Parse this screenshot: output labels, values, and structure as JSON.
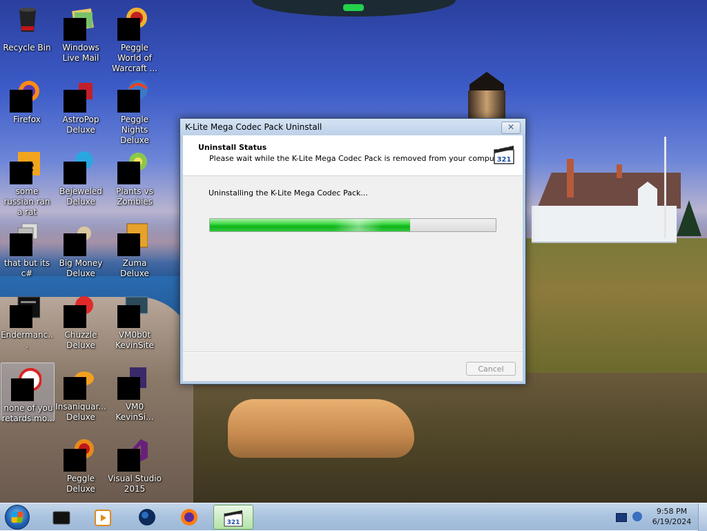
{
  "desktop": {
    "icons": [
      {
        "label": "Recycle Bin",
        "icon": "recycle-bin-icon"
      },
      {
        "label": "Windows Live Mail",
        "icon": "mail-icon"
      },
      {
        "label": "Peggle World of Warcraft ...",
        "icon": "game-icon"
      },
      {
        "label": "Firefox",
        "icon": "firefox-icon"
      },
      {
        "label": "AstroPop Deluxe",
        "icon": "game-icon"
      },
      {
        "label": "Peggle Nights Deluxe",
        "icon": "game-icon"
      },
      {
        "label": "some russian ran a rat",
        "icon": "app-icon"
      },
      {
        "label": "Bejeweled Deluxe",
        "icon": "game-icon"
      },
      {
        "label": "Plants vs Zombies",
        "icon": "game-icon"
      },
      {
        "label": "that but its c#",
        "icon": "app-icon"
      },
      {
        "label": "Big Money Deluxe",
        "icon": "game-icon"
      },
      {
        "label": "Zuma Deluxe",
        "icon": "game-icon"
      },
      {
        "label": "Endermanc...",
        "icon": "app-icon"
      },
      {
        "label": "Chuzzle Deluxe",
        "icon": "game-icon"
      },
      {
        "label": "VM0b0t KevinSite",
        "icon": "vm-icon"
      },
      {
        "label": "none of you retards  mo...",
        "icon": "app-icon"
      },
      {
        "label": "Insaniquar... Deluxe",
        "icon": "game-icon"
      },
      {
        "label": "VM0 KevinSi...",
        "icon": "vm-icon"
      },
      {
        "label": "Peggle Deluxe",
        "icon": "game-icon"
      },
      {
        "label": "Visual Studio 2015",
        "icon": "visual-studio-icon"
      }
    ]
  },
  "dialog": {
    "title": "K-Lite Mega Codec Pack Uninstall",
    "close_label": "✕",
    "header_title": "Uninstall Status",
    "header_subtitle": "Please wait while the K-Lite Mega Codec Pack is removed from your computer.",
    "logo_text": "321",
    "status_text": "Uninstalling the K-Lite Mega Codec Pack...",
    "progress": 0.7,
    "cancel_label": "Cancel",
    "cancel_enabled": false
  },
  "taskbar": {
    "start_icon": "windows-start-icon",
    "items": [
      {
        "icon": "terminal-icon",
        "active": false
      },
      {
        "icon": "media-player-icon",
        "active": false
      },
      {
        "icon": "globe-icon",
        "active": false
      },
      {
        "icon": "firefox-icon",
        "active": false
      },
      {
        "icon": "k-lite-321-icon",
        "active": true,
        "text": "321"
      }
    ],
    "tray": {
      "time": "9:58 PM",
      "date": "6/19/2024"
    }
  },
  "colors": {
    "progress_green": "#1fc028",
    "dialog_frame": "#b9cde4",
    "taskbar": "#a9c2de"
  }
}
